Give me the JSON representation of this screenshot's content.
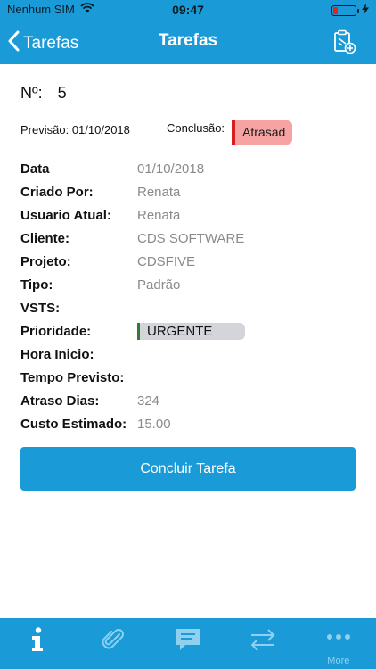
{
  "status_bar": {
    "carrier": "Nenhum SIM",
    "time": "09:47",
    "battery_level": 0.2,
    "battery_color": "#e02424"
  },
  "nav": {
    "back_label": "Tarefas",
    "title": "Tarefas",
    "action_icon": "clipboard-add-icon"
  },
  "task": {
    "number_label": "Nº:",
    "number_value": "5",
    "previsao_label": "Previsão:",
    "previsao_value": "01/10/2018",
    "conclusao_label": "Conclusão:",
    "conclusao_status": "Atrasad",
    "fields": [
      {
        "label": "Data",
        "value": "01/10/2018"
      },
      {
        "label": "Criado Por:",
        "value": "Renata"
      },
      {
        "label": "Usuario Atual:",
        "value": "Renata"
      },
      {
        "label": "Cliente:",
        "value": "CDS SOFTWARE"
      },
      {
        "label": "Projeto:",
        "value": "CDSFIVE"
      },
      {
        "label": "Tipo:",
        "value": "Padrão"
      },
      {
        "label": "VSTS:",
        "value": ""
      },
      {
        "label": "Prioridade:",
        "value": "URGENTE"
      },
      {
        "label": "Hora Inicio:",
        "value": ""
      },
      {
        "label": "Tempo Previsto:",
        "value": ""
      },
      {
        "label": "Atraso Dias:",
        "value": "324"
      },
      {
        "label": "Custo Estimado:",
        "value": "15.00"
      }
    ]
  },
  "actions": {
    "complete_label": "Concluir Tarefa"
  },
  "tab_bar": {
    "tabs": [
      {
        "icon": "info-icon",
        "active": true
      },
      {
        "icon": "paperclip-icon",
        "active": false
      },
      {
        "icon": "comment-icon",
        "active": false
      },
      {
        "icon": "transfer-arrows-icon",
        "active": false
      },
      {
        "icon": "more-dots-icon",
        "label": "More",
        "active": false
      }
    ]
  },
  "colors": {
    "brand": "#1a9bd7",
    "overdue_bg": "#f5a3a3",
    "overdue_accent": "#d91e1e",
    "priority_accent": "#2e7d32",
    "muted_text": "#8a8a8a"
  }
}
